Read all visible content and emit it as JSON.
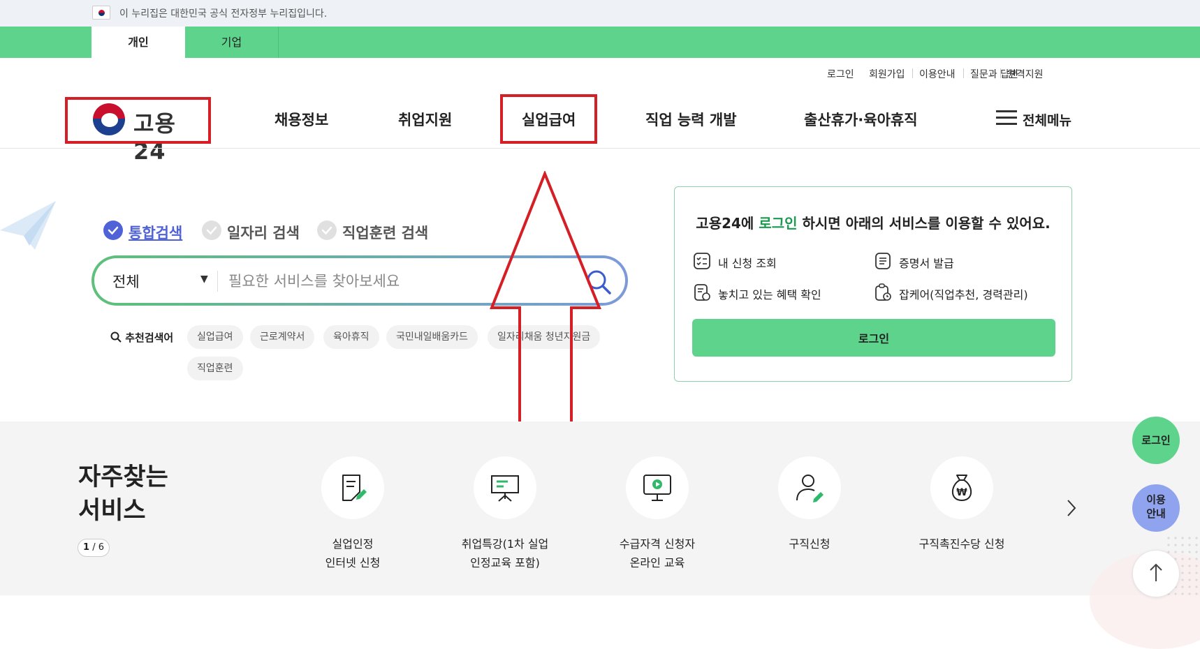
{
  "gov_banner": {
    "text": "이 누리집은 대한민국 공식 전자정부 누리집입니다."
  },
  "user_tabs": [
    {
      "label": "개인"
    },
    {
      "label": "기업"
    }
  ],
  "util_links": [
    "로그인",
    "회원가입",
    "이용안내",
    "질문과 답변",
    "원격지원"
  ],
  "logo": {
    "text": "고용24"
  },
  "nav": {
    "items": [
      "채용정보",
      "취업지원",
      "실업급여",
      "직업 능력 개발",
      "출산휴가·육아휴직"
    ],
    "all_menu": "전체메뉴"
  },
  "search": {
    "types": [
      "통합검색",
      "일자리 검색",
      "직업훈련 검색"
    ],
    "category": "전체",
    "placeholder": "필요한 서비스를 찾아보세요",
    "recommend_label": "추천검색어",
    "keywords": [
      "실업급여",
      "근로계약서",
      "육아휴직",
      "국민내일배움카드",
      "일자리채움 청년지원금",
      "직업훈련"
    ]
  },
  "login_card": {
    "title_pre": "고용24에 ",
    "title_hl": "로그인",
    "title_post": " 하시면 아래의 서비스를 이용할 수 있어요.",
    "services": [
      "내 신청 조회",
      "증명서 발급",
      "놓치고 있는 혜택 확인",
      "잡케어(직업추천, 경력관리)"
    ],
    "button": "로그인"
  },
  "frequent": {
    "title_line1": "자주찾는",
    "title_line2": "서비스",
    "pager_current": "1",
    "pager_total": " / 6",
    "items": [
      {
        "line1": "실업인정",
        "line2": "인터넷 신청",
        "icon": "document-edit-icon"
      },
      {
        "line1": "취업특강(1차 실업",
        "line2": "인정교육 포함)",
        "icon": "presentation-board-icon"
      },
      {
        "line1": "수급자격 신청자",
        "line2": "온라인 교육",
        "icon": "monitor-play-icon"
      },
      {
        "line1": "구직신청",
        "line2": "",
        "icon": "person-edit-icon"
      },
      {
        "line1": "구직촉진수당 신청",
        "line2": "",
        "icon": "money-bag-icon"
      }
    ]
  },
  "floating": {
    "login": "로그인",
    "guide_line1": "이용",
    "guide_line2": "안내"
  },
  "colors": {
    "brand_green": "#5ed38c",
    "annotation_red": "#d51f27",
    "link_green": "#1b9a4f",
    "guide_blue": "#8fa3ef"
  }
}
